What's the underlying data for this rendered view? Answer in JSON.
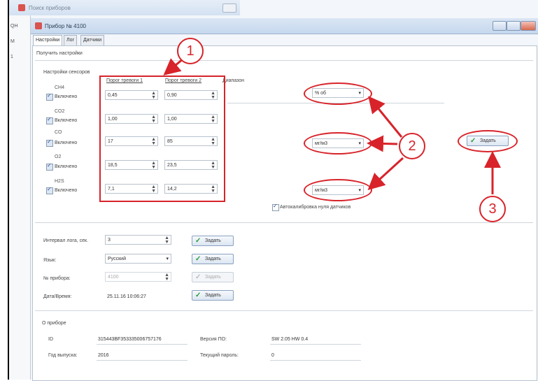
{
  "outer_window": {
    "title": "Поиск приборов",
    "side_labels": [
      "QH",
      "M",
      "1"
    ]
  },
  "inner_window": {
    "title": "Прибор № 4100"
  },
  "tabs": [
    {
      "label": "Настройки"
    },
    {
      "label": "Лог"
    },
    {
      "label": "Датчики"
    }
  ],
  "get_settings_link": "Получить настройки",
  "sensors_group_title": "Настройки сенсоров",
  "column_headers": {
    "threshold1": "Порог тревоги 1",
    "threshold2": "Порог тревоги 2",
    "range": "Диапазон"
  },
  "enabled_label": "Включено",
  "sensors": [
    {
      "name": "CH4",
      "threshold1": "0,45",
      "threshold2": "0,90",
      "range": "% об"
    },
    {
      "name": "CO2",
      "threshold1": "1,00",
      "threshold2": "1,00"
    },
    {
      "name": "CO",
      "threshold1": "17",
      "threshold2": "85",
      "range": "мг/м3"
    },
    {
      "name": "O2",
      "threshold1": "18,5",
      "threshold2": "23,5"
    },
    {
      "name": "H2S",
      "threshold1": "7,1",
      "threshold2": "14,2",
      "range": "мг/м3"
    }
  ],
  "set_button_label": "Задать",
  "autocalibration_label": "Автокалибровка нуля датчиков",
  "settings": {
    "log_interval_label": "Интервал лога, сек.",
    "log_interval_value": "3",
    "language_label": "Язык:",
    "language_value": "Русский",
    "device_no_label": "№ прибора:",
    "device_no_value": "4100",
    "datetime_label": "Дата/Время:",
    "datetime_value": "25.11.16 10:06:27"
  },
  "about": {
    "title": "О приборе",
    "id_label": "ID",
    "id_value": "315443BF353335006757176",
    "fw_label": "Версия ПО:",
    "fw_value": "SW 2.05 HW 0.4",
    "year_label": "Год выпуска:",
    "year_value": "2016",
    "password_label": "Текущий пароль:",
    "password_value": "0"
  },
  "callouts": [
    "1",
    "2",
    "3"
  ],
  "colors": {
    "annotation": "#d8232a",
    "check_icon": "#2c9c3a",
    "title_bar": "#c6d8ee"
  }
}
